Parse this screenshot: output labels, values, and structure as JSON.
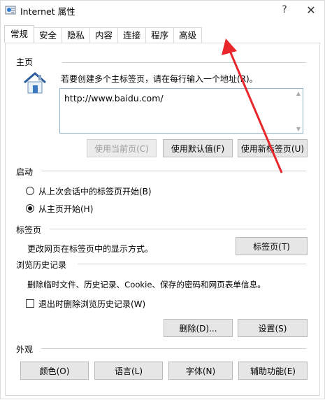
{
  "window": {
    "title": "Internet 属性",
    "help": "?",
    "close": "✕"
  },
  "tabs": [
    "常规",
    "安全",
    "隐私",
    "内容",
    "连接",
    "程序",
    "高级"
  ],
  "home": {
    "label": "主页",
    "instruction": "若要创建多个主标签页，请在每行输入一个地址(R)。",
    "url": "http://www.baidu.com/",
    "buttons": {
      "use_current": "使用当前页(C)",
      "use_default": "使用默认值(F)",
      "use_new_tab": "使用新标签页(U)"
    }
  },
  "startup": {
    "label": "启动",
    "option_last_session": "从上次会话中的标签页开始(B)",
    "option_home": "从主页开始(H)",
    "selected": "option_home"
  },
  "tabs_section": {
    "label": "标签页",
    "desc": "更改网页在标签页中的显示方式。",
    "button": "标签页(T)"
  },
  "history": {
    "label": "浏览历史记录",
    "desc": "删除临时文件、历史记录、Cookie、保存的密码和网页表单信息。",
    "checkbox": "退出时删除浏览历史记录(W)",
    "checked": false,
    "delete_button": "删除(D)...",
    "settings_button": "设置(S)"
  },
  "appearance": {
    "label": "外观",
    "buttons": {
      "colors": "颜色(O)",
      "languages": "语言(L)",
      "fonts": "字体(N)",
      "accessibility": "辅助功能(E)"
    }
  },
  "annotation_color": "#e8262b"
}
